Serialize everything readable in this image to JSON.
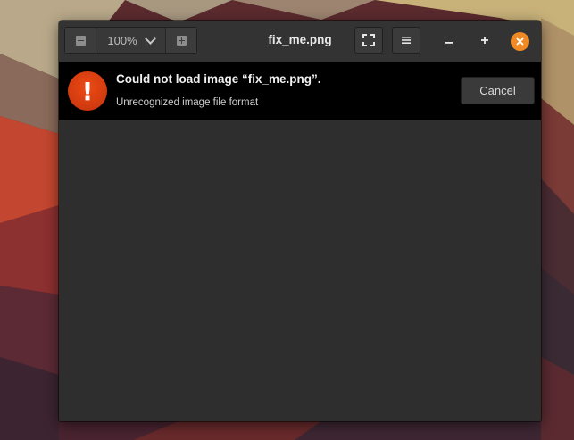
{
  "window": {
    "title": "fix_me.png"
  },
  "toolbar": {
    "zoom_level": "100%",
    "zoom_out_icon": "zoom-out-icon",
    "zoom_in_icon": "zoom-in-icon",
    "zoom_menu_icon": "chevron-down-icon",
    "fullscreen_icon": "fullscreen-icon",
    "menu_icon": "hamburger-menu-icon"
  },
  "window_controls": {
    "minimize_icon": "minimize-icon",
    "maximize_icon": "maximize-icon",
    "close_icon": "close-icon",
    "close_color": "#f08a24"
  },
  "error": {
    "icon": "!",
    "icon_color": "#e8430f",
    "title": "Could not load image “fix_me.png”.",
    "subtitle": "Unrecognized image file format",
    "cancel_label": "Cancel"
  }
}
